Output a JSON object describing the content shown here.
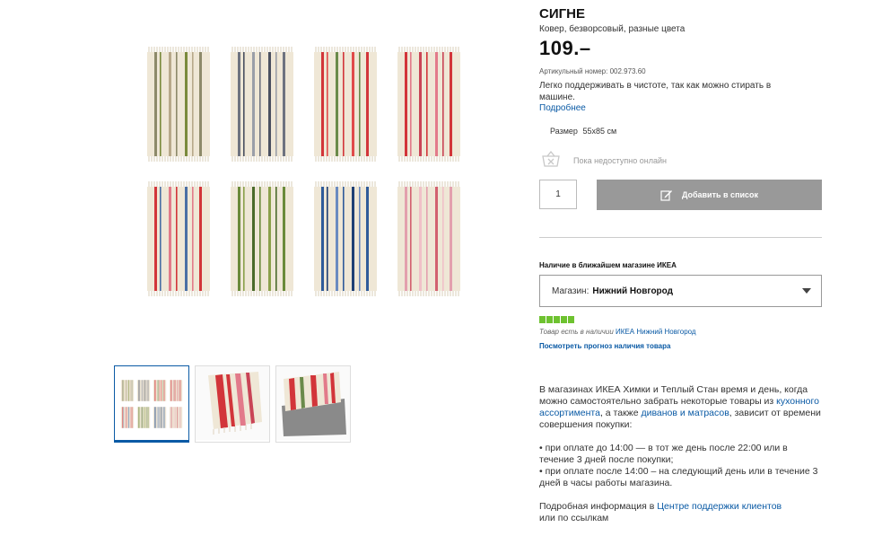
{
  "product": {
    "name": "СИГНЕ",
    "subtitle": "Ковер, безворсовый, разные цвета",
    "price": "109.–",
    "article_label": "Артикульный номер:",
    "article_number": "002.973.60",
    "description": "Легко поддерживать в чистоте, так как можно стирать в машине.",
    "more_link": "Подробнее",
    "size_label": "Размер",
    "size_value": "55x85 см"
  },
  "online": {
    "unavailable_text": "Пока недоступно онлайн",
    "basket_icon": "basket-icon"
  },
  "purchase": {
    "quantity": "1",
    "add_to_list_label": "Добавить в список",
    "add_icon": "edit-list-icon"
  },
  "availability": {
    "heading": "Наличие в ближайшем магазине ИКЕА",
    "store_label": "Магазин:",
    "store_value": "Нижний Новгород",
    "stock_level": 5,
    "stock_max": 5,
    "stock_color": "#6ec230",
    "stock_text": "Товар есть в наличии",
    "stock_store_link": "ИКЕА Нижний Новгород",
    "forecast_link": "Посмотреть прогноз наличия товара"
  },
  "delivery": {
    "p1_a": "В магазинах ИКЕА Химки и Теплый Стан время и день, когда можно самостоятельно забрать некоторые товары из ",
    "p1_link1": "кухонного ассортимента",
    "p1_b": ", а также ",
    "p1_link2": "диванов и матрасов",
    "p1_c": ", зависит от времени совершения покупки:",
    "bullet1": "• при оплате до 14:00 — в тот же день после 22:00 или в течение 3 дней после покупки;",
    "bullet2": "• при оплате после 14:00 – на следующий день или в течение 3 дней в часы работы магазина.",
    "p3_a": "Подробная информация в ",
    "p3_link": "Центре поддержки клиентов",
    "p3_b": " или по ссылкам"
  },
  "gallery": {
    "rugs": [
      {
        "name": "rug-beige-green",
        "stripes": [
          "#8d8a6a",
          "#7a8a3c",
          "#b7a88a"
        ]
      },
      {
        "name": "rug-grey-blue",
        "stripes": [
          "#6e7380",
          "#4a5060",
          "#9a9ea8"
        ]
      },
      {
        "name": "rug-red-green",
        "stripes": [
          "#d2353a",
          "#e04a4a",
          "#6a8a4a"
        ]
      },
      {
        "name": "rug-red-pink",
        "stripes": [
          "#d2353a",
          "#e27a8a",
          "#c94456"
        ]
      },
      {
        "name": "rug-red-blue",
        "stripes": [
          "#d2353a",
          "#4a6fa5",
          "#e27a8a"
        ]
      },
      {
        "name": "rug-green-olive",
        "stripes": [
          "#6a8a3a",
          "#8aa04a",
          "#4a6a2a"
        ]
      },
      {
        "name": "rug-blue-navy",
        "stripes": [
          "#2f5b9a",
          "#1f3f74",
          "#6a8ac0"
        ]
      },
      {
        "name": "rug-pink-red",
        "stripes": [
          "#e3a0ae",
          "#d2606f",
          "#f0c0c8"
        ]
      }
    ]
  }
}
